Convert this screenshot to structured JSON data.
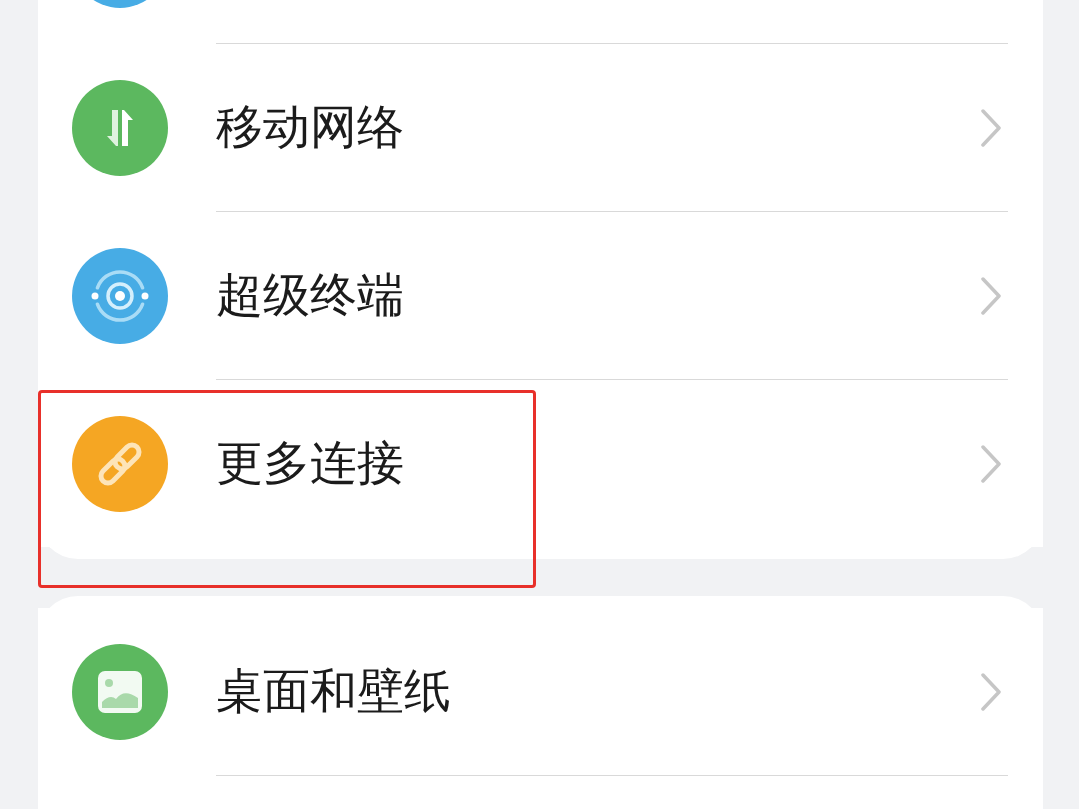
{
  "groups": [
    {
      "continues_below": false,
      "items": [
        {
          "kind": "cut_off",
          "color": "#47ace5"
        },
        {
          "kind": "arrows",
          "color": "#5cb85f",
          "label": "移动网络",
          "highlighted": false
        },
        {
          "kind": "target",
          "color": "#47ace5",
          "label": "超级终端",
          "highlighted": false
        },
        {
          "kind": "link",
          "color": "#f5a623",
          "label": "更多连接",
          "highlighted": true
        }
      ]
    },
    {
      "continues_below": true,
      "items": [
        {
          "kind": "picture",
          "color": "#5cb85f",
          "label": "桌面和壁纸",
          "highlighted": false
        }
      ]
    }
  ]
}
